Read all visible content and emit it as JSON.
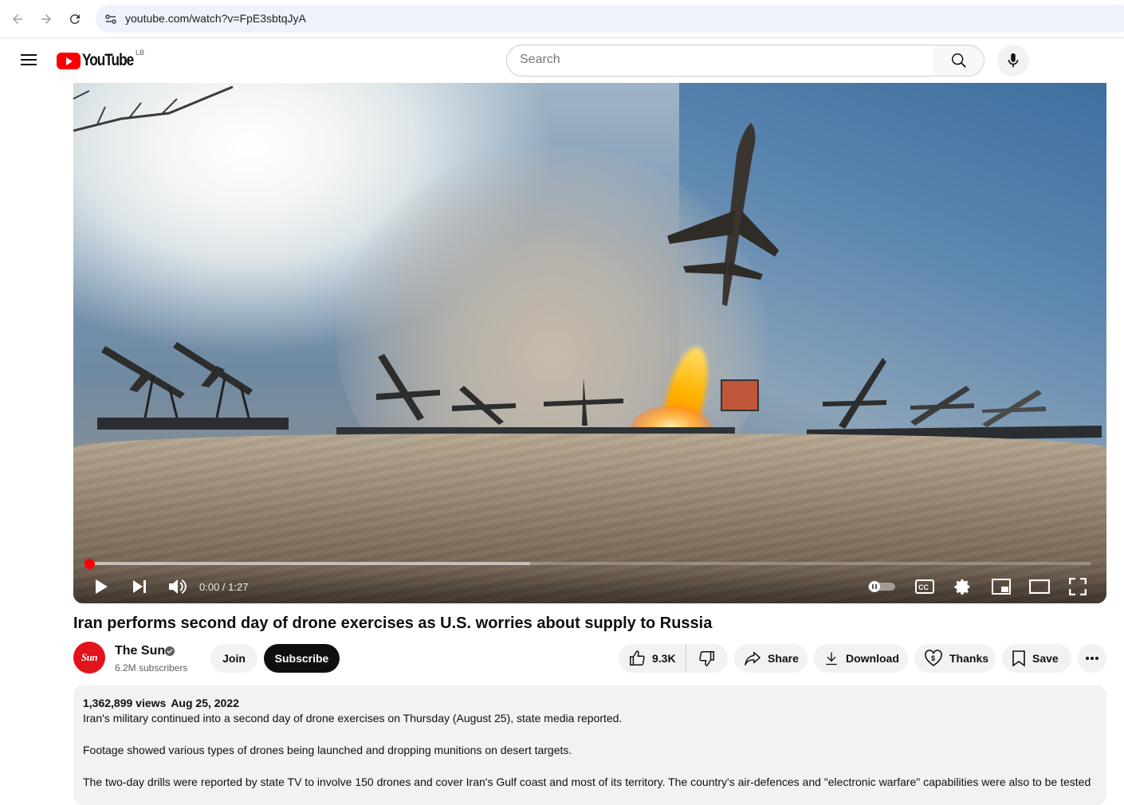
{
  "browser": {
    "url": "youtube.com/watch?v=FpE3sbtqJyA"
  },
  "masthead": {
    "logo_text": "YouTube",
    "country_code": "LB",
    "search_placeholder": "Search"
  },
  "player": {
    "time_display": "0:00 / 1:27",
    "progress_fraction": 0.0,
    "buffered_fraction": 0.44
  },
  "video": {
    "title": "Iran performs second day of drone exercises as U.S. worries about supply to Russia"
  },
  "channel": {
    "avatar_text": "Sun",
    "name": "The Sun",
    "subscribers": "6.2M subscribers"
  },
  "actions": {
    "join": "Join",
    "subscribe": "Subscribe",
    "likes": "9.3K",
    "share": "Share",
    "download": "Download",
    "thanks": "Thanks",
    "save": "Save"
  },
  "description": {
    "views": "1,362,899 views",
    "date": "Aug 25, 2022",
    "lines": [
      "Iran's military continued into a second day of drone exercises on Thursday (August 25), state media reported.",
      "Footage showed various types of drones being launched and dropping munitions on desert targets.",
      "The two-day drills were reported by state TV to involve 150 drones and cover Iran's Gulf coast and most of its territory. The country's air-defences and \"electronic warfare\" capabilities were also to be tested"
    ]
  },
  "colors": {
    "brand_red": "#ff0000",
    "progress_red": "#ff0000",
    "subscribe_bg": "#0f0f0f",
    "pill_bg": "#f2f2f2"
  }
}
